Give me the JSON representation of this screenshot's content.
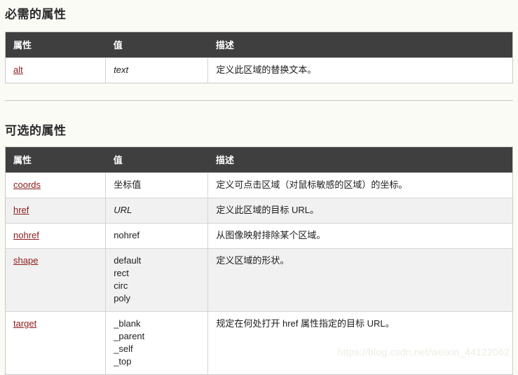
{
  "sections": [
    {
      "title": "必需的属性",
      "columns": [
        "属性",
        "值",
        "描述"
      ],
      "rows": [
        {
          "attr": "alt",
          "value": "text",
          "value_style": "italic",
          "desc": "定义此区域的替换文本。"
        }
      ]
    },
    {
      "title": "可选的属性",
      "columns": [
        "属性",
        "值",
        "描述"
      ],
      "rows": [
        {
          "attr": "coords",
          "value": "坐标值",
          "value_style": "plain",
          "desc": "定义可点击区域（对鼠标敏感的区域）的坐标。"
        },
        {
          "attr": "href",
          "value": "URL",
          "value_style": "italic",
          "desc": "定义此区域的目标 URL。"
        },
        {
          "attr": "nohref",
          "value": "nohref",
          "value_style": "plain",
          "desc": "从图像映射排除某个区域。"
        },
        {
          "attr": "shape",
          "value": "default\nrect\ncirc\npoly",
          "value_style": "plain",
          "desc": "定义区域的形状。"
        },
        {
          "attr": "target",
          "value": "_blank\n_parent\n_self\n_top",
          "value_style": "plain",
          "desc": "规定在何处打开 href 属性指定的目标 URL。"
        }
      ]
    }
  ],
  "watermark": "https://blog.csdn.net/weixin_44122062",
  "colors": {
    "header_bg": "#403f3f",
    "header_text": "#ffffff",
    "link": "#8b1b1b",
    "page_bg": "#fbfbf6",
    "alt_row_bg": "#f1f1f1",
    "border": "#d4d4d4"
  }
}
